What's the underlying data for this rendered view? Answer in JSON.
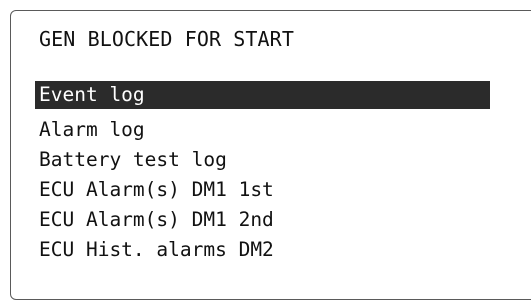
{
  "screen": {
    "title": "GEN BLOCKED FOR START"
  },
  "menu": {
    "selected_index": 0,
    "items": [
      {
        "label": "Event log"
      },
      {
        "label": "Alarm log"
      },
      {
        "label": "Battery test log"
      },
      {
        "label": "ECU Alarm(s) DM1 1st"
      },
      {
        "label": "ECU Alarm(s) DM1 2nd"
      },
      {
        "label": "ECU Hist. alarms DM2"
      }
    ]
  },
  "colors": {
    "selection_background": "#2b2b2b",
    "selection_text": "#ffffff",
    "text": "#111111",
    "border": "#5a5a5a"
  }
}
